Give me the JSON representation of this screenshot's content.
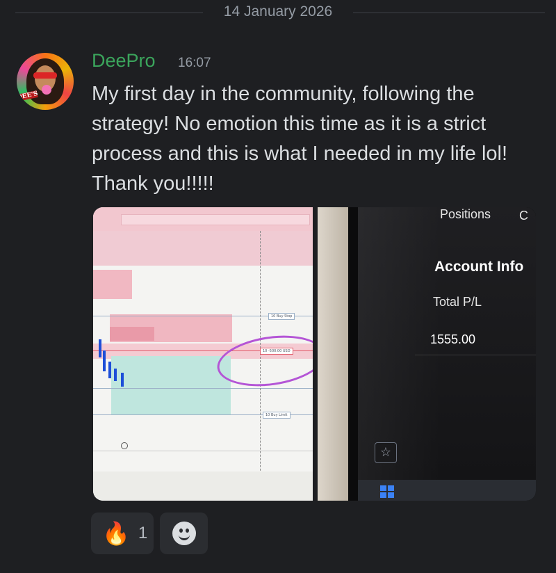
{
  "date_divider": "14 January 2026",
  "message": {
    "author": "DeePro",
    "author_color": "#3ba55c",
    "timestamp": "16:07",
    "text": "My first day in the community, following the\nstrategy!  No emotion this time as it is a strict\nprocess and this is what I needed in my life lol!\nThank you!!!!!"
  },
  "avatar": {
    "badge_text": "DEE'S"
  },
  "attachments": [
    {
      "kind": "photo-trading-chart",
      "order_labels": [
        "Buy Stop",
        "-500.00 USD",
        "Buy Limit"
      ],
      "order_quantities": [
        "10",
        "10",
        "10"
      ]
    },
    {
      "kind": "photo-monitor",
      "tab_label": "Positions",
      "heading": "Account Info",
      "label": "Total P/L",
      "value": "1555.00"
    }
  ],
  "reactions": [
    {
      "emoji": "🔥",
      "count": "1"
    }
  ],
  "add_reaction_icon": "smiley-icon"
}
